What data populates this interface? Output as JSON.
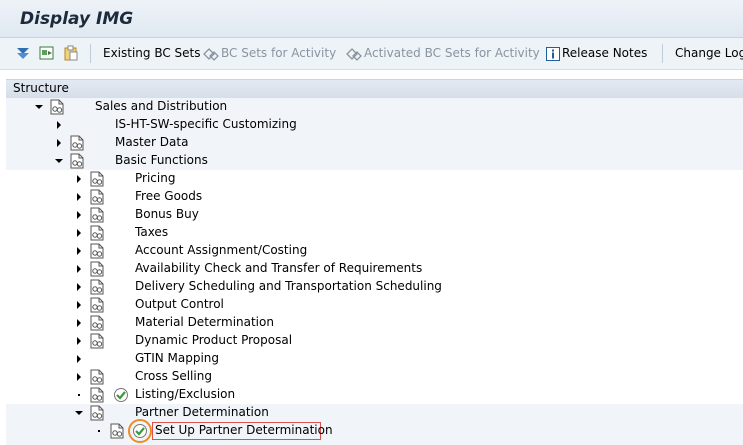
{
  "window": {
    "title": "Display IMG"
  },
  "toolbar": {
    "existing_bc_sets": "Existing BC Sets",
    "bc_sets_for_activity": "BC Sets for Activity",
    "activated_bc_sets": "Activated BC Sets for Activity",
    "release_notes": "Release Notes",
    "change_log": "Change Log"
  },
  "structure": {
    "header": "Structure"
  },
  "tree": {
    "sales_distribution": "Sales and Distribution",
    "is_ht": "IS-HT-SW-specific Customizing",
    "master_data": "Master Data",
    "basic_functions": "Basic Functions",
    "pricing": "Pricing",
    "free_goods": "Free Goods",
    "bonus_buy": "Bonus Buy",
    "taxes": "Taxes",
    "account_assignment": "Account Assignment/Costing",
    "availability_check": "Availability Check and Transfer of Requirements",
    "delivery_scheduling": "Delivery Scheduling and Transportation Scheduling",
    "output_control": "Output Control",
    "material_determination": "Material Determination",
    "dynamic_product_proposal": "Dynamic Product Proposal",
    "gtin_mapping": "GTIN Mapping",
    "cross_selling": "Cross Selling",
    "listing_exclusion": "Listing/Exclusion",
    "partner_determination": "Partner Determination",
    "setup_partner_determination": "Set Up Partner Determination"
  },
  "colors": {
    "highlight_border": "#d9534f",
    "circle": "#f08a24",
    "exec_green": "#3a9a3a"
  }
}
